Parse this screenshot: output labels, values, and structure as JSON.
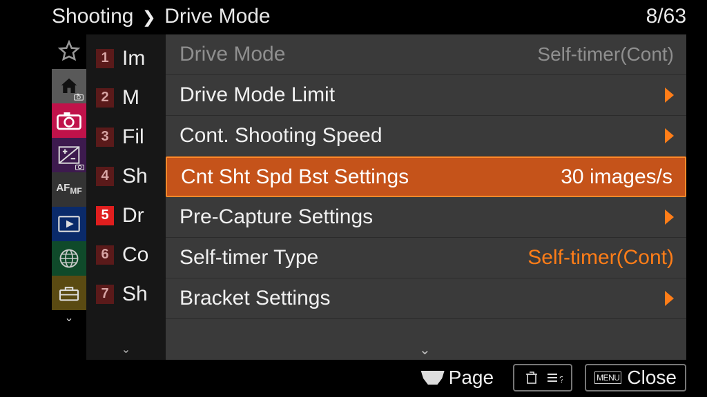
{
  "breadcrumb": {
    "root": "Shooting",
    "page": "Drive Mode"
  },
  "page_counter": "8/63",
  "subtabs": [
    {
      "num": "1",
      "label": "Im",
      "active": false
    },
    {
      "num": "2",
      "label": "M",
      "active": false
    },
    {
      "num": "3",
      "label": "Fil",
      "active": false
    },
    {
      "num": "4",
      "label": "Sh",
      "active": false
    },
    {
      "num": "5",
      "label": "Dr",
      "active": true
    },
    {
      "num": "6",
      "label": "Co",
      "active": false
    },
    {
      "num": "7",
      "label": "Sh",
      "active": false
    }
  ],
  "header": {
    "label": "Drive Mode",
    "value": "Self-timer(Cont)"
  },
  "items": [
    {
      "label": "Drive Mode Limit",
      "value": "",
      "arrow": true,
      "selected": false
    },
    {
      "label": "Cont. Shooting Speed",
      "value": "",
      "arrow": true,
      "selected": false
    },
    {
      "label": "Cnt Sht Spd Bst Settings",
      "value": "30 images/s",
      "arrow": false,
      "selected": true
    },
    {
      "label": "Pre-Capture Settings",
      "value": "",
      "arrow": true,
      "selected": false
    },
    {
      "label": "Self-timer Type",
      "value": "Self-timer(Cont)",
      "arrow": false,
      "selected": false,
      "orange": true
    },
    {
      "label": "Bracket Settings",
      "value": "",
      "arrow": true,
      "selected": false
    }
  ],
  "bottom": {
    "page_label": "Page",
    "help_label": "",
    "close_label": "Close",
    "menu_label": "MENU"
  }
}
